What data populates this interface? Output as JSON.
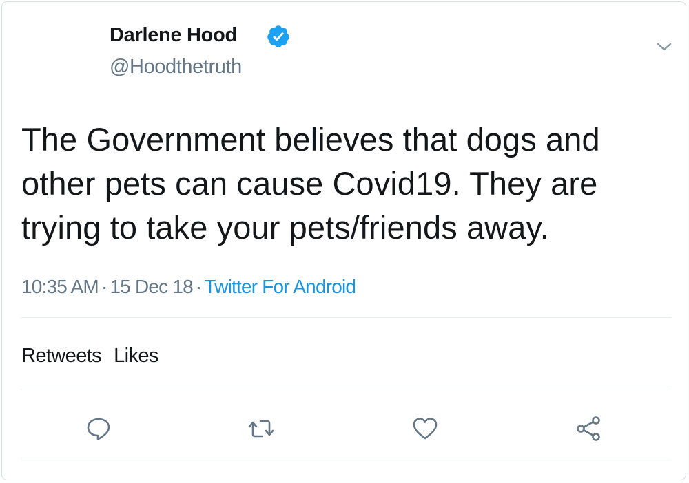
{
  "author": {
    "display_name": "Darlene Hood",
    "handle": "@Hoodthetruth",
    "verified_icon": "verified-badge-icon"
  },
  "tweet": {
    "text": "The Government believes that dogs and other pets can cause Covid19. They are trying to take your pets/friends away."
  },
  "meta": {
    "time": "10:35 AM",
    "separator": "·",
    "date": "15 Dec 18",
    "source": "Twitter For Android"
  },
  "stats": {
    "retweets_label": "Retweets",
    "likes_label": "Likes"
  },
  "actions": {
    "reply_icon": "reply-icon",
    "retweet_icon": "retweet-icon",
    "like_icon": "heart-icon",
    "share_icon": "share-icon",
    "menu_icon": "chevron-down-icon"
  },
  "colors": {
    "verified": "#1da1f2",
    "link": "#1b95e0",
    "secondary_text": "#657786",
    "primary_text": "#14171a",
    "icon": "#657786"
  }
}
